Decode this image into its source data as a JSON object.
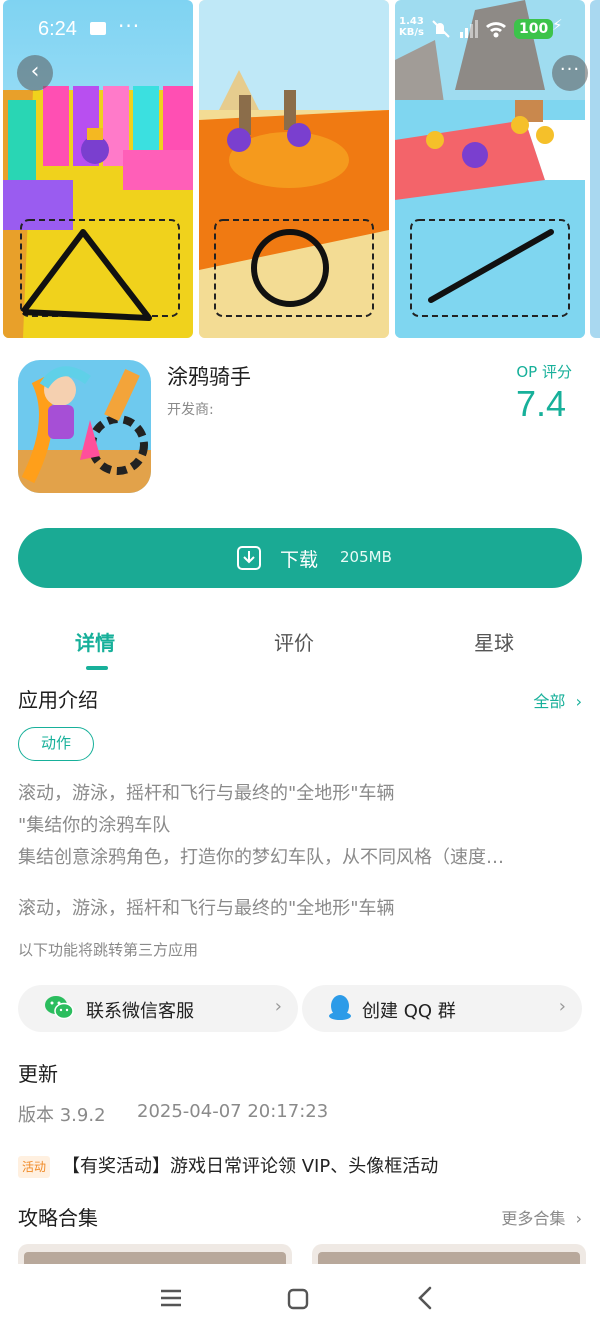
{
  "status_bar": {
    "time": "6:24",
    "net_speed_value": "1.43",
    "net_speed_unit": "KB/s",
    "battery": "100"
  },
  "gallery": {
    "back_icon": "back-arrow-icon",
    "more_icon": "more-dots-icon",
    "shapes": [
      "triangle",
      "circle",
      "line"
    ]
  },
  "app": {
    "name": "涂鸦骑手",
    "developer_label": "开发商:",
    "score_label": "OP 评分",
    "score": "7.4"
  },
  "download": {
    "label": "下载",
    "size": "205MB"
  },
  "tabs": [
    {
      "label": "详情",
      "active": true
    },
    {
      "label": "评价",
      "active": false
    },
    {
      "label": "星球",
      "active": false
    }
  ],
  "intro": {
    "title": "应用介绍",
    "see_all": "全部",
    "tag": "动作",
    "lines": [
      "滚动，游泳，摇杆和飞行与最终的\"全地形\"车辆",
      "\"集结你的涂鸦车队",
      "集结创意涂鸦角色，打造你的梦幻车队，从不同风格（速度…",
      "滚动，游泳，摇杆和飞行与最终的\"全地形\"车辆"
    ],
    "third_party_note": "以下功能将跳转第三方应用"
  },
  "contacts": [
    {
      "label": "联系微信客服",
      "icon": "wechat-icon"
    },
    {
      "label": "创建 QQ 群",
      "icon": "qq-icon"
    }
  ],
  "update": {
    "title": "更新",
    "version": "版本 3.9.2",
    "date": "2025-04-07 20:17:23",
    "event_badge": "活动",
    "event_text": "【有奖活动】游戏日常评论领 VIP、头像框活动"
  },
  "guides": {
    "title": "攻略合集",
    "more": "更多合集"
  },
  "colors": {
    "accent": "#17b09a",
    "download_bg": "#1aaa94",
    "battery": "#3cc34a",
    "event_badge": "#f08a26"
  }
}
